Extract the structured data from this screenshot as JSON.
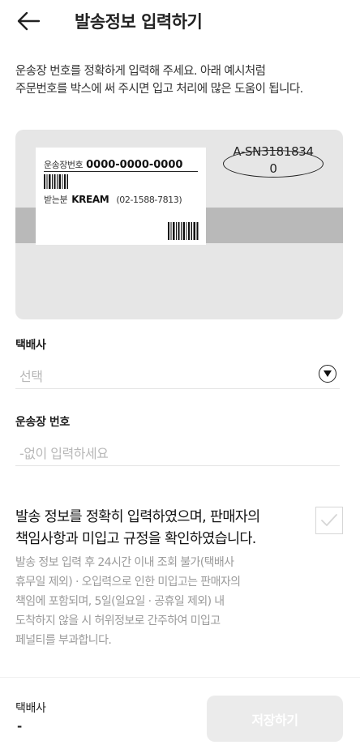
{
  "header": {
    "back_icon": "arrow-left-icon",
    "title": "발송정보 입력하기"
  },
  "description": {
    "line1": "운송장 번호를 정확하게 입력해 주세요. 아래 예시처럼",
    "line2": "주문번호를 박스에 써 주시면 입고 처리에 많은 도움이 됩니다."
  },
  "example": {
    "tracking_label": "운송장번호",
    "tracking_number": "0000-0000-0000",
    "receiver_label": "받는분",
    "receiver_name": "KREAM",
    "receiver_phone": "(02-1588-7813)",
    "order_number_line1": "A-SN3181834",
    "order_number_line2": "0"
  },
  "courier": {
    "label": "택배사",
    "placeholder": "선택",
    "dropdown_icon": "chevron-down-icon"
  },
  "tracking": {
    "label": "운송장 번호",
    "placeholder": "-없이 입력하세요"
  },
  "confirm": {
    "title_line1": "발송 정보를 정확히 입력하였으며, 판매자의",
    "title_line2": "책임사항과 미입고 규정을 확인하였습니다.",
    "body_line1": "발송 정보 입력 후 24시간 이내 조회 불가(택배사",
    "body_line2": "휴무일 제외) · 오입력으로 인한 미입고는 판매자의",
    "body_line3": "책임에 포함되며, 5일(일요일 · 공휴일 제외) 내",
    "body_line4": "도착하지 않을 시 허위정보로 간주하여 미입고",
    "body_line5": "페널티를 부과합니다.",
    "checked": false,
    "check_icon": "check-icon"
  },
  "footer": {
    "courier_label": "택배사",
    "courier_value": "-",
    "save_label": "저장하기"
  },
  "colors": {
    "save_disabled_bg": "#ebebeb",
    "placeholder": "#b8b8b8",
    "illustration_bg": "#e6e6e6",
    "illustration_band": "#b9b9b9"
  }
}
